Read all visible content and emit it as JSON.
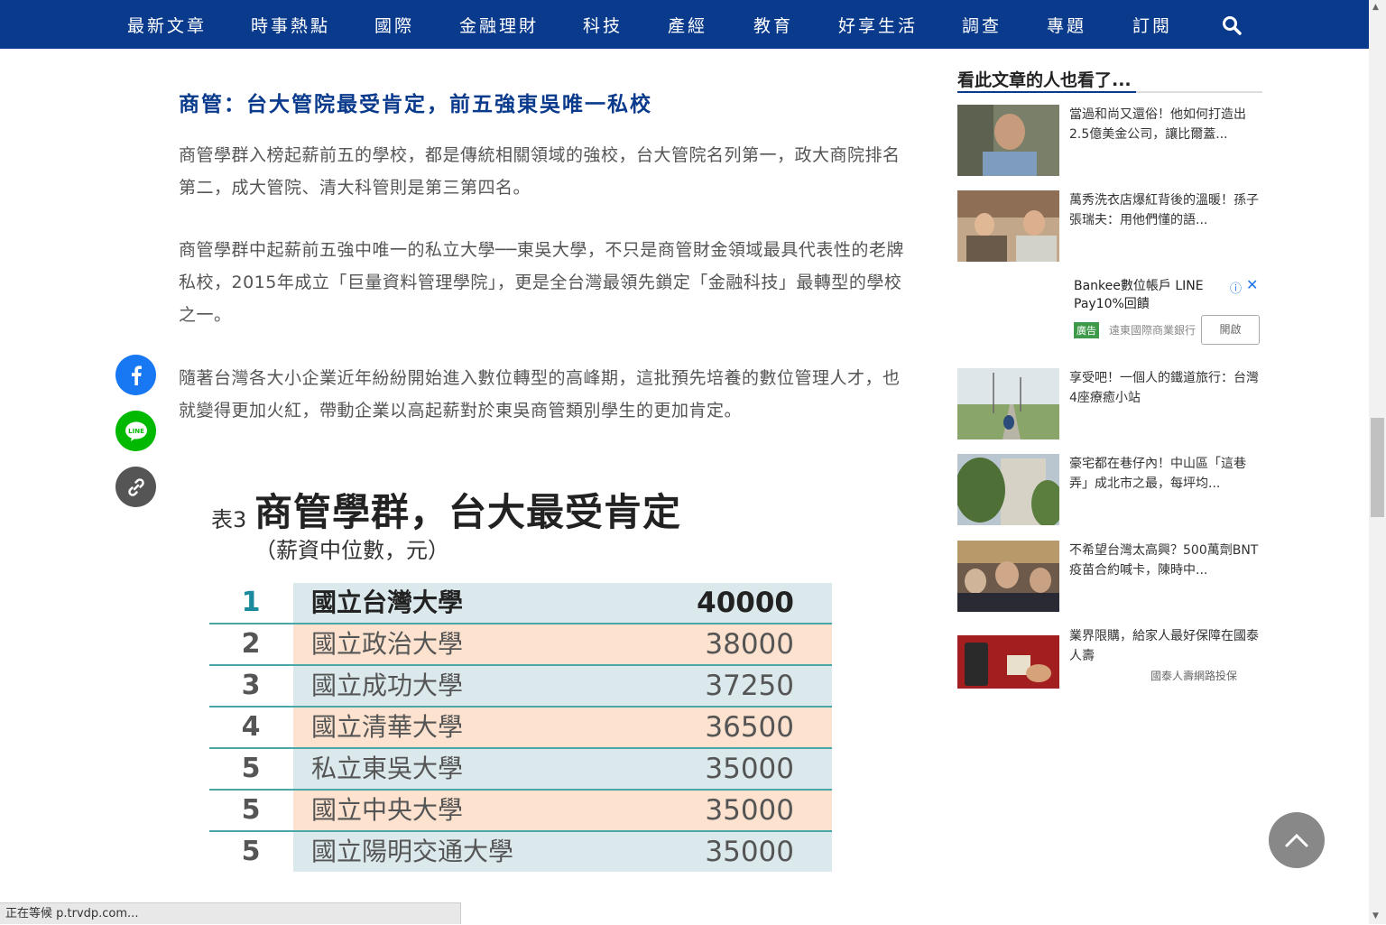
{
  "nav": {
    "items": [
      "最新文章",
      "時事熱點",
      "國際",
      "金融理財",
      "科技",
      "產經",
      "教育",
      "好享生活",
      "調查",
      "專題",
      "訂閱"
    ]
  },
  "article": {
    "sub_heading": "商管：台大管院最受肯定，前五強東吳唯一私校",
    "paragraphs": [
      "商管學群入榜起薪前五的學校，都是傳統相關領域的強校，台大管院名列第一，政大商院排名第二，成大管院、清大科管則是第三第四名。",
      "商管學群中起薪前五強中唯一的私立大學──東吳大學，不只是商管財金領域最具代表性的老牌私校，2015年成立「巨量資料管理學院」，更是全台灣最領先鎖定「金融科技」最轉型的學校之一。",
      "隨著台灣各大小企業近年紛紛開始進入數位轉型的高峰期，這批預先培養的數位管理人才，也就變得更加火紅，帶動企業以高起薪對於東吳商管類別學生的更加肯定。"
    ]
  },
  "figure": {
    "prefix": "表3",
    "title": "商管學群，台大最受肯定",
    "unit": "（薪資中位數，元）"
  },
  "chart_data": {
    "type": "table",
    "title": "商管學群，台大最受肯定",
    "subtitle": "（薪資中位數，元）",
    "rows": [
      {
        "rank": "1",
        "school": "國立台灣大學",
        "salary": "40000"
      },
      {
        "rank": "2",
        "school": "國立政治大學",
        "salary": "38000"
      },
      {
        "rank": "3",
        "school": "國立成功大學",
        "salary": "37250"
      },
      {
        "rank": "4",
        "school": "國立清華大學",
        "salary": "36500"
      },
      {
        "rank": "5",
        "school": "私立東吳大學",
        "salary": "35000"
      },
      {
        "rank": "5",
        "school": "國立中央大學",
        "salary": "35000"
      },
      {
        "rank": "5",
        "school": "國立陽明交通大學",
        "salary": "35000"
      }
    ]
  },
  "sidebar": {
    "title": "看此文章的人也看了...",
    "recs": [
      {
        "text": "當過和尚又還俗！他如何打造出2.5億美金公司，讓比爾蓋..."
      },
      {
        "text": "萬秀洗衣店爆紅背後的溫暖！孫子張瑞夫：用他們懂的語..."
      },
      {
        "text": "享受吧！一個人的鐵道旅行：台灣4座療癒小站"
      },
      {
        "text": "豪宅都在巷仔內！中山區「這巷弄」成北市之最，每坪均..."
      },
      {
        "text": "不希望台灣太高興？500萬劑BNT疫苗合約喊卡，陳時中..."
      },
      {
        "text": "業界限購，給家人最好保障在國泰人壽"
      }
    ],
    "ad": {
      "text": "Bankee數位帳戶 LINE Pay10%回饋",
      "badge": "廣告",
      "sponsor": "遠東國際商業銀行",
      "open": "開啟"
    },
    "sponsor2": "國泰人壽網路投保"
  },
  "status_bar": "正在等候 p.trvdp.com..."
}
